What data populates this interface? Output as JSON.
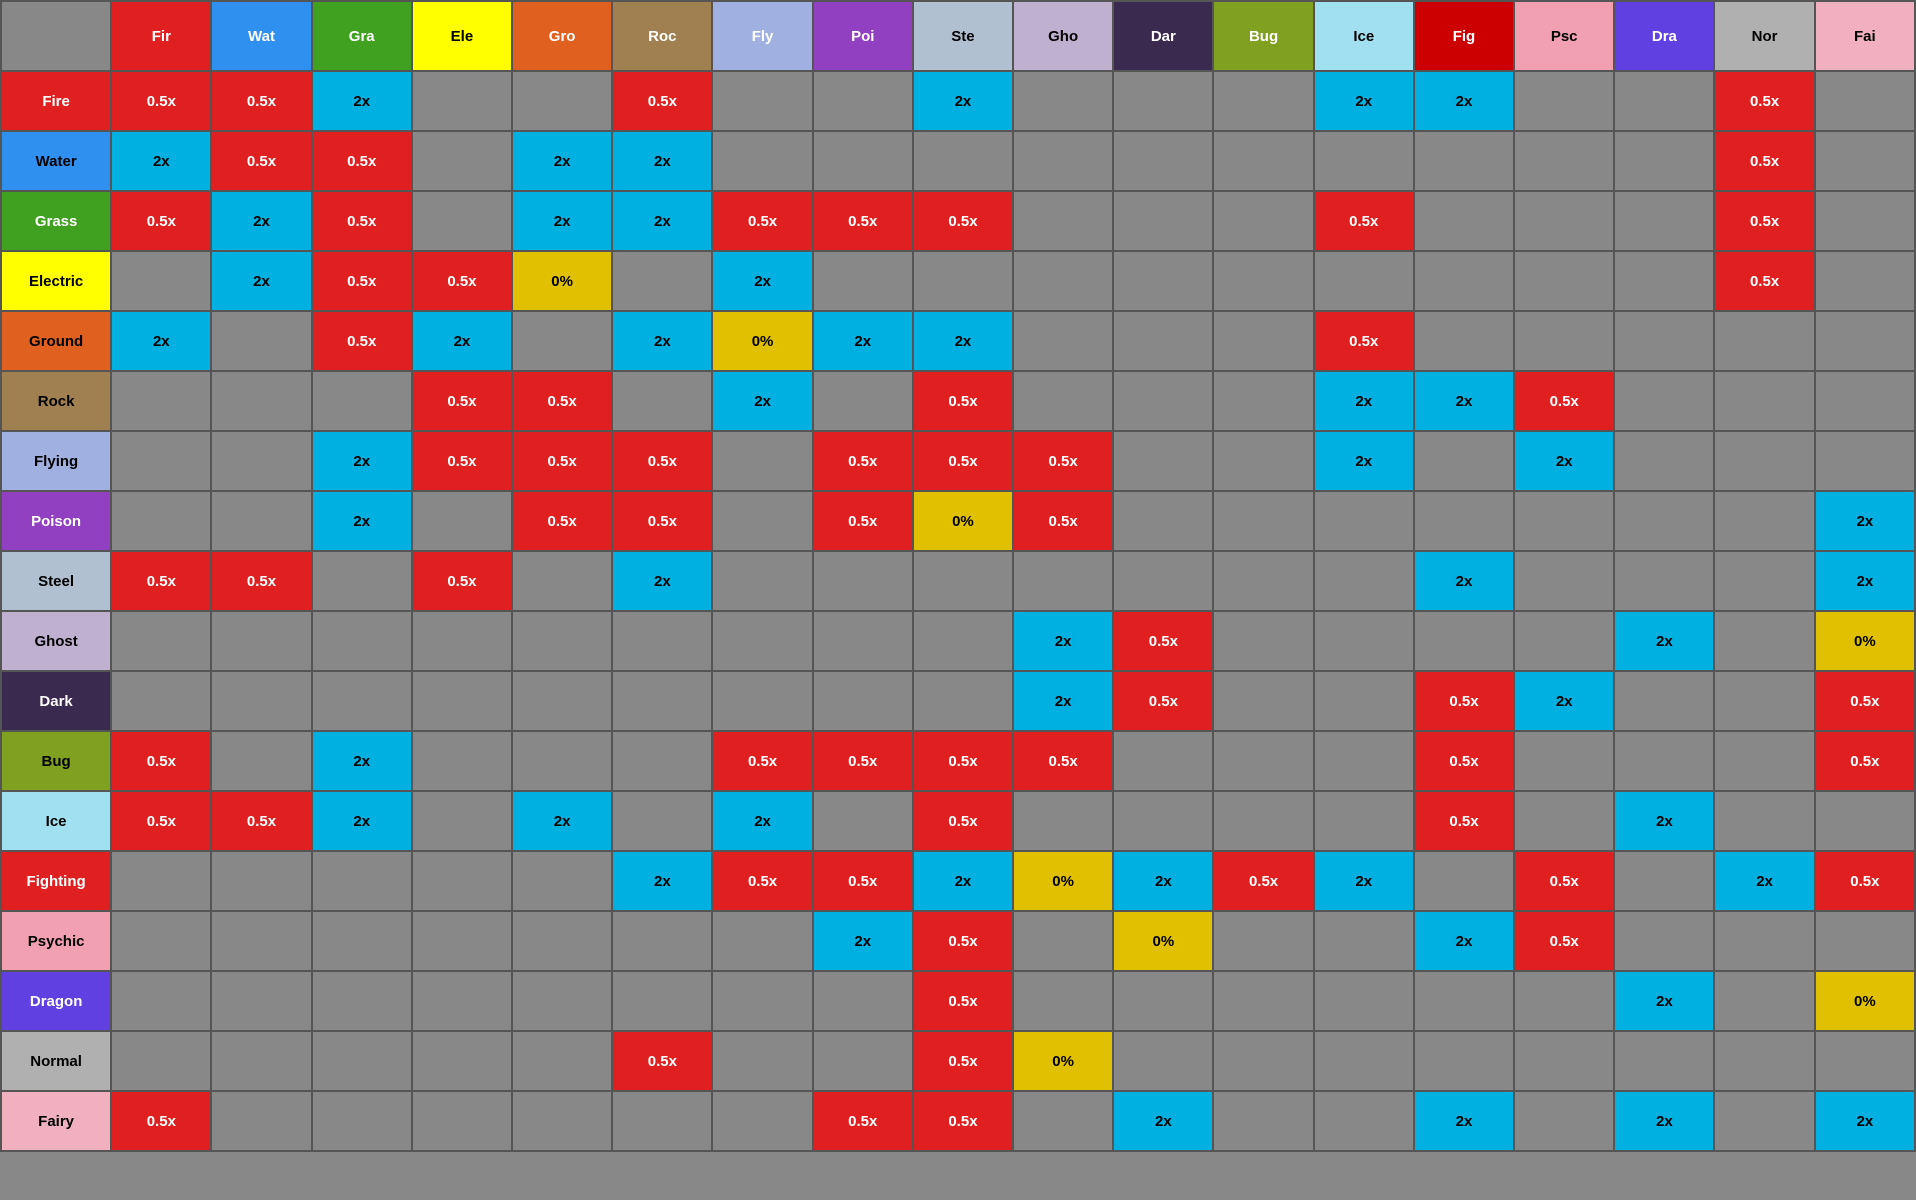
{
  "headers": {
    "cols": [
      {
        "label": "Fir",
        "cls": "ch-fir"
      },
      {
        "label": "Wat",
        "cls": "ch-wat"
      },
      {
        "label": "Gra",
        "cls": "ch-gra"
      },
      {
        "label": "Ele",
        "cls": "ch-ele"
      },
      {
        "label": "Gro",
        "cls": "ch-gro"
      },
      {
        "label": "Roc",
        "cls": "ch-roc"
      },
      {
        "label": "Fly",
        "cls": "ch-fly"
      },
      {
        "label": "Poi",
        "cls": "ch-poi"
      },
      {
        "label": "Ste",
        "cls": "ch-ste"
      },
      {
        "label": "Gho",
        "cls": "ch-gho"
      },
      {
        "label": "Dar",
        "cls": "ch-dar"
      },
      {
        "label": "Bug",
        "cls": "ch-bug"
      },
      {
        "label": "Ice",
        "cls": "ch-ice"
      },
      {
        "label": "Fig",
        "cls": "ch-fig"
      },
      {
        "label": "Psc",
        "cls": "ch-psc"
      },
      {
        "label": "Dra",
        "cls": "ch-dra"
      },
      {
        "label": "Nor",
        "cls": "ch-nor"
      },
      {
        "label": "Fai",
        "cls": "ch-fai"
      }
    ],
    "rows": [
      {
        "label": "Fire",
        "cls": "rh-fire"
      },
      {
        "label": "Water",
        "cls": "rh-water"
      },
      {
        "label": "Grass",
        "cls": "rh-grass"
      },
      {
        "label": "Electric",
        "cls": "rh-electric"
      },
      {
        "label": "Ground",
        "cls": "rh-ground"
      },
      {
        "label": "Rock",
        "cls": "rh-rock"
      },
      {
        "label": "Flying",
        "cls": "rh-flying"
      },
      {
        "label": "Poison",
        "cls": "rh-poison"
      },
      {
        "label": "Steel",
        "cls": "rh-steel"
      },
      {
        "label": "Ghost",
        "cls": "rh-ghost"
      },
      {
        "label": "Dark",
        "cls": "rh-dark"
      },
      {
        "label": "Bug",
        "cls": "rh-bug"
      },
      {
        "label": "Ice",
        "cls": "rh-ice"
      },
      {
        "label": "Fighting",
        "cls": "rh-fighting"
      },
      {
        "label": "Psychic",
        "cls": "rh-psychic"
      },
      {
        "label": "Dragon",
        "cls": "rh-dragon"
      },
      {
        "label": "Normal",
        "cls": "rh-normal"
      },
      {
        "label": "Fairy",
        "cls": "rh-fairy"
      }
    ]
  },
  "matrix": [
    [
      "half",
      "half",
      "2x",
      "",
      "",
      "half",
      "",
      "",
      "2x",
      "",
      "",
      "",
      "2x",
      "2x",
      "",
      "",
      "half",
      ""
    ],
    [
      "2x",
      "half",
      "half",
      "",
      "2x",
      "2x",
      "",
      "",
      "",
      "",
      "",
      "",
      "",
      "",
      "",
      "",
      "half",
      ""
    ],
    [
      "half",
      "2x",
      "half",
      "",
      "2x",
      "2x",
      "half",
      "half",
      "half",
      "",
      "",
      "",
      "half",
      "",
      "",
      "",
      "half",
      ""
    ],
    [
      "",
      "2x",
      "half",
      "half",
      "0%",
      "",
      "2x",
      "",
      "",
      "",
      "",
      "",
      "",
      "",
      "",
      "",
      "half",
      ""
    ],
    [
      "2x",
      "",
      "half",
      "2x",
      "",
      "2x",
      "0%",
      "2x",
      "2x",
      "",
      "",
      "",
      "half",
      "",
      "",
      "",
      "",
      ""
    ],
    [
      "",
      "",
      "",
      "half",
      "half",
      "",
      "2x",
      "",
      "half",
      "",
      "",
      "",
      "2x",
      "2x",
      "half",
      "",
      "",
      ""
    ],
    [
      "",
      "",
      "2x",
      "half",
      "half",
      "half",
      "",
      "half",
      "half",
      "half",
      "",
      "",
      "2x",
      "",
      "2x",
      "",
      "",
      ""
    ],
    [
      "",
      "",
      "2x",
      "",
      "half",
      "half",
      "",
      "half",
      "0%",
      "half",
      "",
      "",
      "",
      "",
      "",
      "",
      "",
      "2x"
    ],
    [
      "half",
      "half",
      "",
      "half",
      "",
      "2x",
      "",
      "",
      "",
      "",
      "",
      "",
      "",
      "2x",
      "",
      "",
      "",
      "2x"
    ],
    [
      "",
      "",
      "",
      "",
      "",
      "",
      "",
      "",
      "",
      "2x",
      "half",
      "",
      "",
      "",
      "",
      "2x",
      "",
      "0%"
    ],
    [
      "",
      "",
      "",
      "",
      "",
      "",
      "",
      "",
      "",
      "2x",
      "half",
      "",
      "",
      "half",
      "2x",
      "",
      "",
      "half"
    ],
    [
      "half",
      "",
      "2x",
      "",
      "",
      "",
      "half",
      "half",
      "half",
      "half",
      "",
      "",
      "",
      "half",
      "",
      "",
      "",
      "half"
    ],
    [
      "half",
      "half",
      "2x",
      "",
      "2x",
      "",
      "2x",
      "",
      "half",
      "",
      "",
      "",
      "",
      "half",
      "",
      "2x",
      "",
      ""
    ],
    [
      "",
      "",
      "",
      "",
      "",
      "2x",
      "half",
      "half",
      "2x",
      "0%",
      "2x",
      "half",
      "2x",
      "",
      "half",
      "",
      "2x",
      "half"
    ],
    [
      "",
      "",
      "",
      "",
      "",
      "",
      "",
      "2x",
      "half",
      "",
      "0%",
      "",
      "",
      "2x",
      "half",
      "",
      "",
      ""
    ],
    [
      "",
      "",
      "",
      "",
      "",
      "",
      "",
      "",
      "half",
      "",
      "",
      "",
      "",
      "",
      "",
      "2x",
      "",
      "0%"
    ],
    [
      "",
      "",
      "",
      "",
      "",
      "half",
      "",
      "",
      "half",
      "0%",
      "",
      "",
      "",
      "",
      "",
      "",
      "",
      ""
    ],
    [
      "half",
      "",
      "",
      "",
      "",
      "",
      "",
      "half",
      "half",
      "",
      "2x",
      "",
      "",
      "2x",
      "",
      "2x",
      "",
      "2x"
    ]
  ]
}
